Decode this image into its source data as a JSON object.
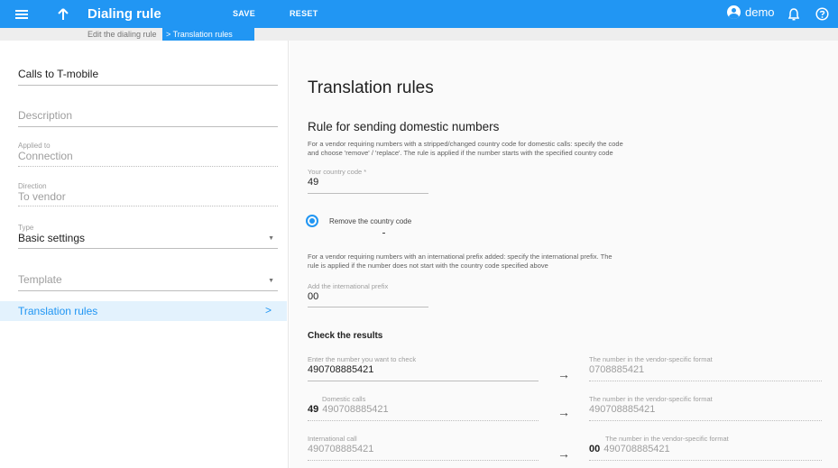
{
  "topbar": {
    "title": "Dialing rule",
    "save_label": "SAVE",
    "reset_label": "RESET",
    "user_name": "demo",
    "menu_icon": "menu-icon",
    "up_icon": "arrow-up-icon",
    "bell_icon": "bell-icon",
    "help_icon": "help-icon",
    "accent": "#2196f3"
  },
  "breadcrumb": {
    "item1": "Edit the dialing rule",
    "item2": "> Translation rules"
  },
  "left": {
    "name_value": "Calls to T-mobile",
    "description_placeholder": "Description",
    "applied_label": "Applied to",
    "applied_value": "Connection",
    "direction_label": "Direction",
    "direction_value": "To vendor",
    "type_label": "Type",
    "type_value": "Basic settings",
    "template_placeholder": "Template",
    "nav_item": "Translation rules",
    "nav_chevron": ">"
  },
  "right": {
    "title": "Translation rules",
    "section_title": "Rule for sending domestic numbers",
    "domestic_help": "For a vendor requiring numbers with a stripped/changed country code for domestic calls: specify the code and choose 'remove' / 'replace'. The rule is applied if the number starts with the specified country code",
    "country_code_label": "Your country code *",
    "country_code_value": "49",
    "radio_label": "Remove the country code",
    "intl_help": "For a vendor requiring numbers with an international prefix added: specify the international prefix. The rule is applied if the number does not start with the country code specified above",
    "intl_prefix_label": "Add the international prefix",
    "intl_prefix_value": "00",
    "check_title": "Check the results",
    "check_input_label": "Enter the number you want to check",
    "check_input_value": "490708885421",
    "result1_label": "The number in the vendor-specific format",
    "result1_value": "0708885421",
    "domestic_label": "Domestic calls",
    "domestic_prefix": "49",
    "domestic_value": "490708885421",
    "result2_label": "The number in the vendor-specific format",
    "result2_value": "490708885421",
    "intl_label": "International call",
    "intl_value": "490708885421",
    "result3_label": "The number in the vendor-specific format",
    "result3_prefix": "00",
    "result3_value": "490708885421",
    "arrow_glyph": "→"
  }
}
